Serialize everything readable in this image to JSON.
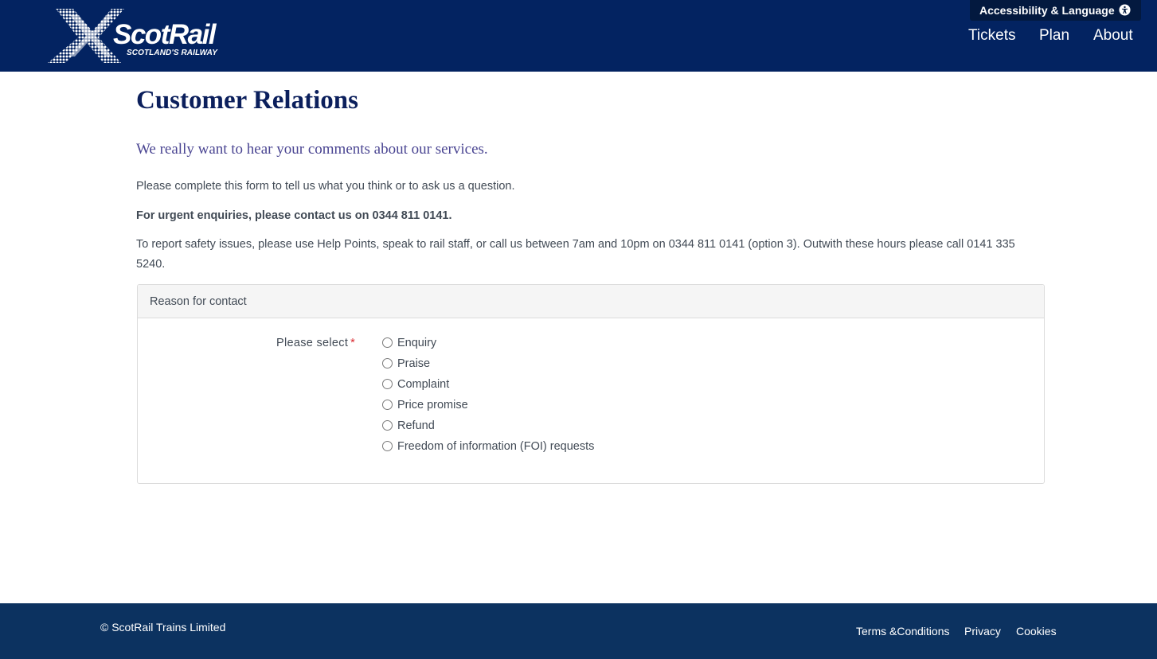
{
  "header": {
    "logo": {
      "name": "ScotRail",
      "tagline": "SCOTLAND'S RAILWAY",
      "icon": "saltire-x-logo"
    },
    "accessibility_label": "Accessibility & Language",
    "accessibility_icon": "accessibility-person-icon",
    "nav": [
      "Tickets",
      "Plan",
      "About"
    ]
  },
  "main": {
    "title": "Customer Relations",
    "lead": "We really want to hear your comments about our services.",
    "paragraphs": [
      "Please complete this form to tell us what you think or to ask us a question.",
      "For urgent enquiries, please contact us on 0344 811 0141.",
      "To report safety issues, please use Help Points, speak to rail staff, or call us between 7am and 10pm on 0344 811 0141 (option 3). Outwith these hours please call 0141 335 5240."
    ],
    "panel": {
      "heading": "Reason for contact",
      "field_label": "Please select",
      "required_marker": "*",
      "options": [
        "Enquiry",
        "Praise",
        "Complaint",
        "Price promise",
        "Refund",
        "Freedom of information (FOI) requests"
      ],
      "selected": null
    }
  },
  "footer": {
    "copyright": "© ScotRail Trains Limited",
    "links": [
      "Terms &Conditions",
      "Privacy",
      "Cookies"
    ]
  },
  "colors": {
    "header_bg": "#032361",
    "footer_bg": "#0c3260",
    "title": "#0b1f5c",
    "lead": "#4a4592",
    "body_text": "#414a55",
    "required": "#d9292f"
  }
}
